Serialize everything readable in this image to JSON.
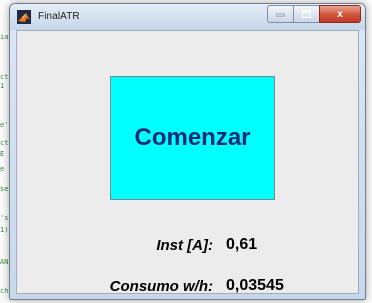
{
  "window": {
    "title": "FinalATR",
    "icon": "matlab-icon"
  },
  "caption_buttons": {
    "minimize_icon": "minimize-icon",
    "maximize_icon": "maximize-icon",
    "close_label": "x"
  },
  "main": {
    "start_button_label": "Comenzar",
    "inst_label": "Inst [A]:",
    "inst_value": "0,61",
    "consumo_label": "Consumo w/h:",
    "consumo_value": "0,03545"
  },
  "colors": {
    "button_bg": "#00ffff",
    "button_text": "#0a2a7a",
    "close_red": "#c0392b",
    "client_bg": "#ececec"
  }
}
